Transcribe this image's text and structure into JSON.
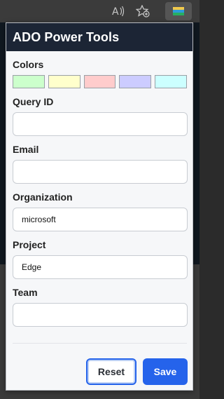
{
  "browser_toolbar": {
    "read_aloud_icon": "read-aloud-icon",
    "favorites_icon": "add-favorite-icon",
    "extension_icon": "extension-icon"
  },
  "popup": {
    "title": "ADO Power Tools",
    "colors": {
      "label": "Colors",
      "swatches": [
        "#ccffcc",
        "#ffffcc",
        "#ffcccc",
        "#ccccff",
        "#ccffff"
      ]
    },
    "fields": {
      "query_id": {
        "label": "Query ID",
        "value": ""
      },
      "email": {
        "label": "Email",
        "value": ""
      },
      "organization": {
        "label": "Organization",
        "value": "microsoft"
      },
      "project": {
        "label": "Project",
        "value": "Edge"
      },
      "team": {
        "label": "Team",
        "value": ""
      }
    },
    "buttons": {
      "reset": "Reset",
      "save": "Save"
    },
    "accent_color": "#2563eb",
    "header_color": "#1c2535"
  }
}
